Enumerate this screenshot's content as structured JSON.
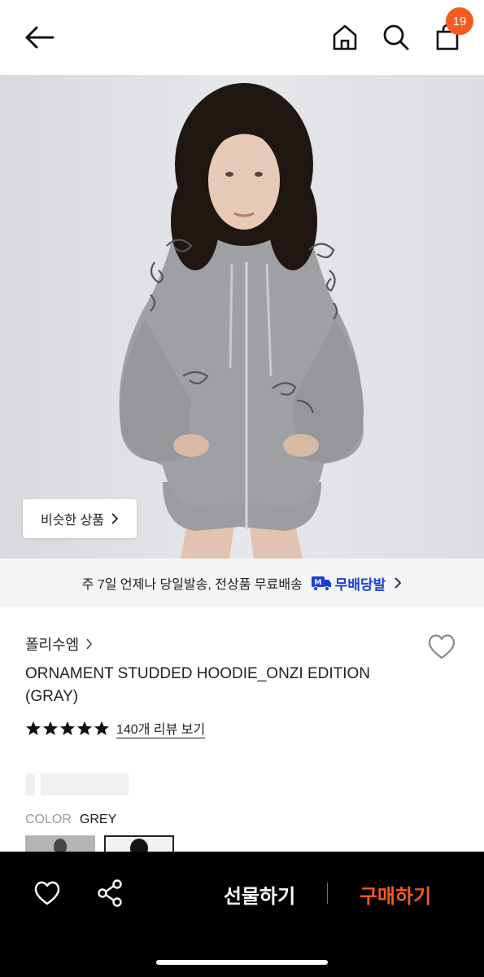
{
  "header": {
    "back_icon": "arrow-left-icon",
    "home_icon": "home-icon",
    "search_icon": "search-icon",
    "cart_icon": "shopping-bag-icon",
    "cart_count": "19",
    "badge_color": "#f55a1e"
  },
  "hero": {
    "similar_button_label": "비슷한 상품"
  },
  "shipping": {
    "text": "주 7일 언제나 당일발송, 전상품 무료배송",
    "badge_label": "무배당발",
    "badge_color": "#1b3fd6"
  },
  "product": {
    "brand": "폴리수엠",
    "title": "ORNAMENT STUDDED HOODIE_ONZI EDITION (GRAY)",
    "rating_stars": 5,
    "review_link": "140개 리뷰 보기",
    "color_label": "COLOR",
    "color_value": "GREY"
  },
  "bottom_bar": {
    "gift_label": "선물하기",
    "buy_label": "구매하기",
    "accent_color": "#f55a1e"
  }
}
